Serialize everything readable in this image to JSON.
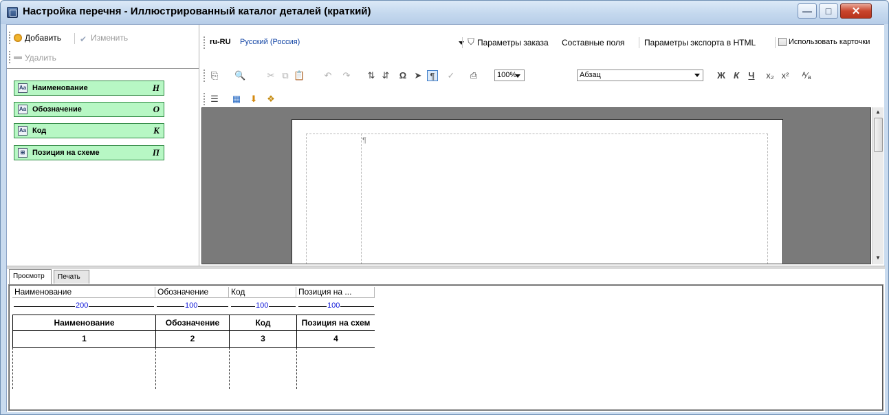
{
  "window": {
    "title": "Настройка перечня - Иллюстрированный каталог деталей (краткий)",
    "buttons": {
      "minimize": "—",
      "maximize": "□",
      "close": "✕"
    }
  },
  "left_toolbar": {
    "add_label": "Добавить",
    "edit_label": "Изменить",
    "delete_label": "Удалить"
  },
  "fields": [
    {
      "label": "Наименование",
      "key": "Н",
      "icon": "text-field-icon"
    },
    {
      "label": "Обозначение",
      "key": "О",
      "icon": "text-field-icon"
    },
    {
      "label": "Код",
      "key": "К",
      "icon": "text-field-icon"
    },
    {
      "label": "Позиция на схеме",
      "key": "П",
      "icon": "scheme-position-icon"
    }
  ],
  "editor_toolbar": {
    "lang_code": "ru-RU",
    "lang_name": "Русский (Россия)",
    "order_params": "Параметры заказа",
    "composite_fields": "Составные поля",
    "html_export": "Параметры экспорта в HTML",
    "use_cards": "Использовать карточки",
    "zoom": "100%",
    "style": "Абзац",
    "bold_glyph": "Ж",
    "italic_glyph": "К",
    "underline_glyph": "Ч"
  },
  "document": {
    "pilcrow": "¶"
  },
  "tabs": [
    {
      "label": "Просмотр",
      "active": true
    },
    {
      "label": "Печать",
      "active": false
    }
  ],
  "preview": {
    "columns": [
      {
        "header": "Наименование",
        "width": "200",
        "title": "Наименование",
        "number": "1"
      },
      {
        "header": "Обозначение",
        "width": "100",
        "title": "Обозначение",
        "number": "2"
      },
      {
        "header": "Код",
        "width": "100",
        "title": "Код",
        "number": "3"
      },
      {
        "header": "Позиция на ...",
        "width": "100",
        "title": "Позиция на схем",
        "number": "4"
      }
    ]
  }
}
